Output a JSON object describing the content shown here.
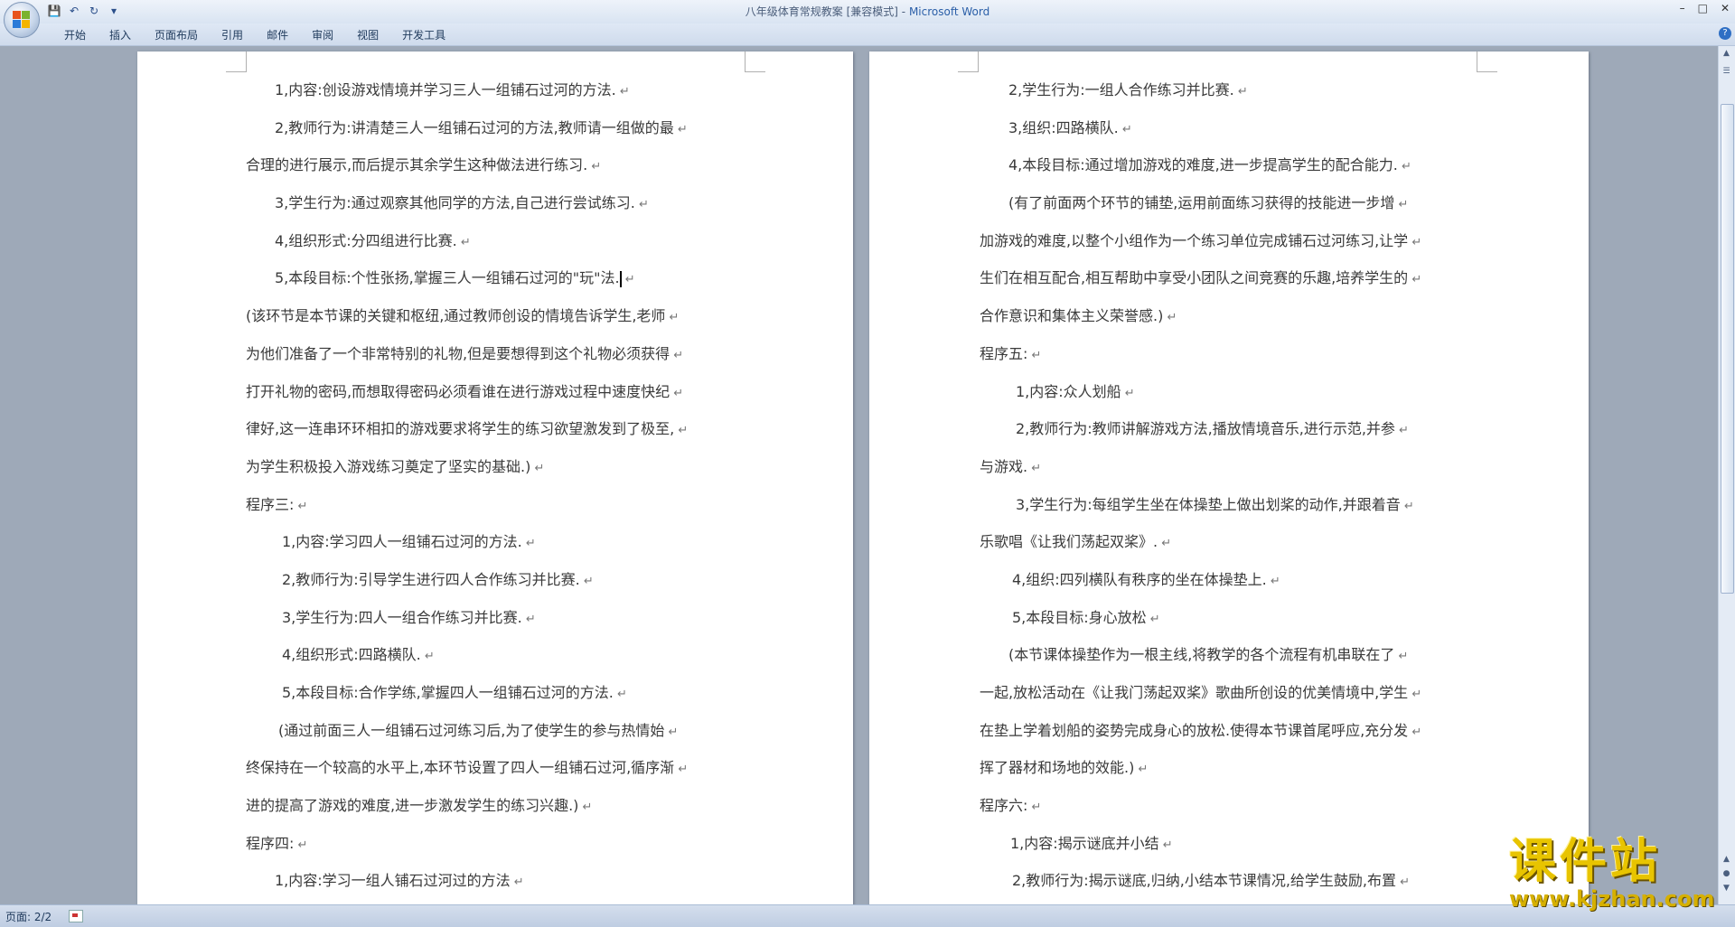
{
  "window": {
    "title": "八年级体育常规教案 [兼容模式]",
    "app_name": "Microsoft Word",
    "title_separator": "-"
  },
  "ribbon": {
    "tabs": [
      "开始",
      "插入",
      "页面布局",
      "引用",
      "邮件",
      "审阅",
      "视图",
      "开发工具"
    ]
  },
  "document": {
    "left_page_lines": [
      "1,内容:创设游戏情境并学习三人一组铺石过河的方法.",
      "2,教师行为:讲清楚三人一组铺石过河的方法,教师请一组做的最",
      "合理的进行展示,而后提示其余学生这种做法进行练习.",
      "3,学生行为:通过观察其他同学的方法,自己进行尝试练习.",
      "4,组织形式:分四组进行比赛.",
      "5,本段目标:个性张扬,掌握三人一组铺石过河的\"玩\"法.",
      "(该环节是本节课的关键和枢纽,通过教师创设的情境告诉学生,老师",
      "为他们准备了一个非常特别的礼物,但是要想得到这个礼物必须获得",
      "打开礼物的密码,而想取得密码必须看谁在进行游戏过程中速度快纪",
      "律好,这一连串环环相扣的游戏要求将学生的练习欲望激发到了极至,",
      "为学生积极投入游戏练习奠定了坚实的基础.)",
      "程序三:",
      "1,内容:学习四人一组铺石过河的方法.",
      "2,教师行为:引导学生进行四人合作练习并比赛.",
      "3,学生行为:四人一组合作练习并比赛.",
      "4,组织形式:四路横队.",
      "5,本段目标:合作学练,掌握四人一组铺石过河的方法.",
      "(通过前面三人一组铺石过河练习后,为了使学生的参与热情始",
      "终保持在一个较高的水平上,本环节设置了四人一组铺石过河,循序渐",
      "进的提高了游戏的难度,进一步激发学生的练习兴趣.)",
      "程序四:",
      "1,内容:学习一组人铺石过河过的方法"
    ],
    "right_page_lines": [
      "2,学生行为:一组人合作练习并比赛.",
      "3,组织:四路横队.",
      "4,本段目标:通过增加游戏的难度,进一步提高学生的配合能力.",
      "(有了前面两个环节的铺垫,运用前面练习获得的技能进一步增",
      "加游戏的难度,以整个小组作为一个练习单位完成铺石过河练习,让学",
      "生们在相互配合,相互帮助中享受小团队之间竞赛的乐趣,培养学生的",
      "合作意识和集体主义荣誉感.)",
      "程序五:",
      "1,内容:众人划船",
      "2,教师行为:教师讲解游戏方法,播放情境音乐,进行示范,并参",
      "与游戏.",
      "3,学生行为:每组学生坐在体操垫上做出划桨的动作,并跟着音",
      "乐歌唱《让我们荡起双桨》.",
      "4,组织:四列横队有秩序的坐在体操垫上.",
      "5,本段目标:身心放松",
      "(本节课体操垫作为一根主线,将教学的各个流程有机串联在了",
      "一起,放松活动在《让我门荡起双桨》歌曲所创设的优美情境中,学生",
      "在垫上学着划船的姿势完成身心的放松.使得本节课首尾呼应,充分发",
      "挥了器材和场地的效能.)",
      "程序六:",
      "1,内容:揭示谜底并小结",
      "2,教师行为:揭示谜底,归纳,小结本节课情况,给学生鼓励,布置"
    ]
  },
  "statusbar": {
    "page_info": "页面: 2/2"
  },
  "watermark": {
    "text": "课件站",
    "url": "www.kjzhan.com"
  },
  "colors": {
    "title_bar": "#dfe8f5",
    "workspace": "#9ea9b8",
    "watermark": "#e8c400",
    "app_name": "#2b5fa8"
  }
}
